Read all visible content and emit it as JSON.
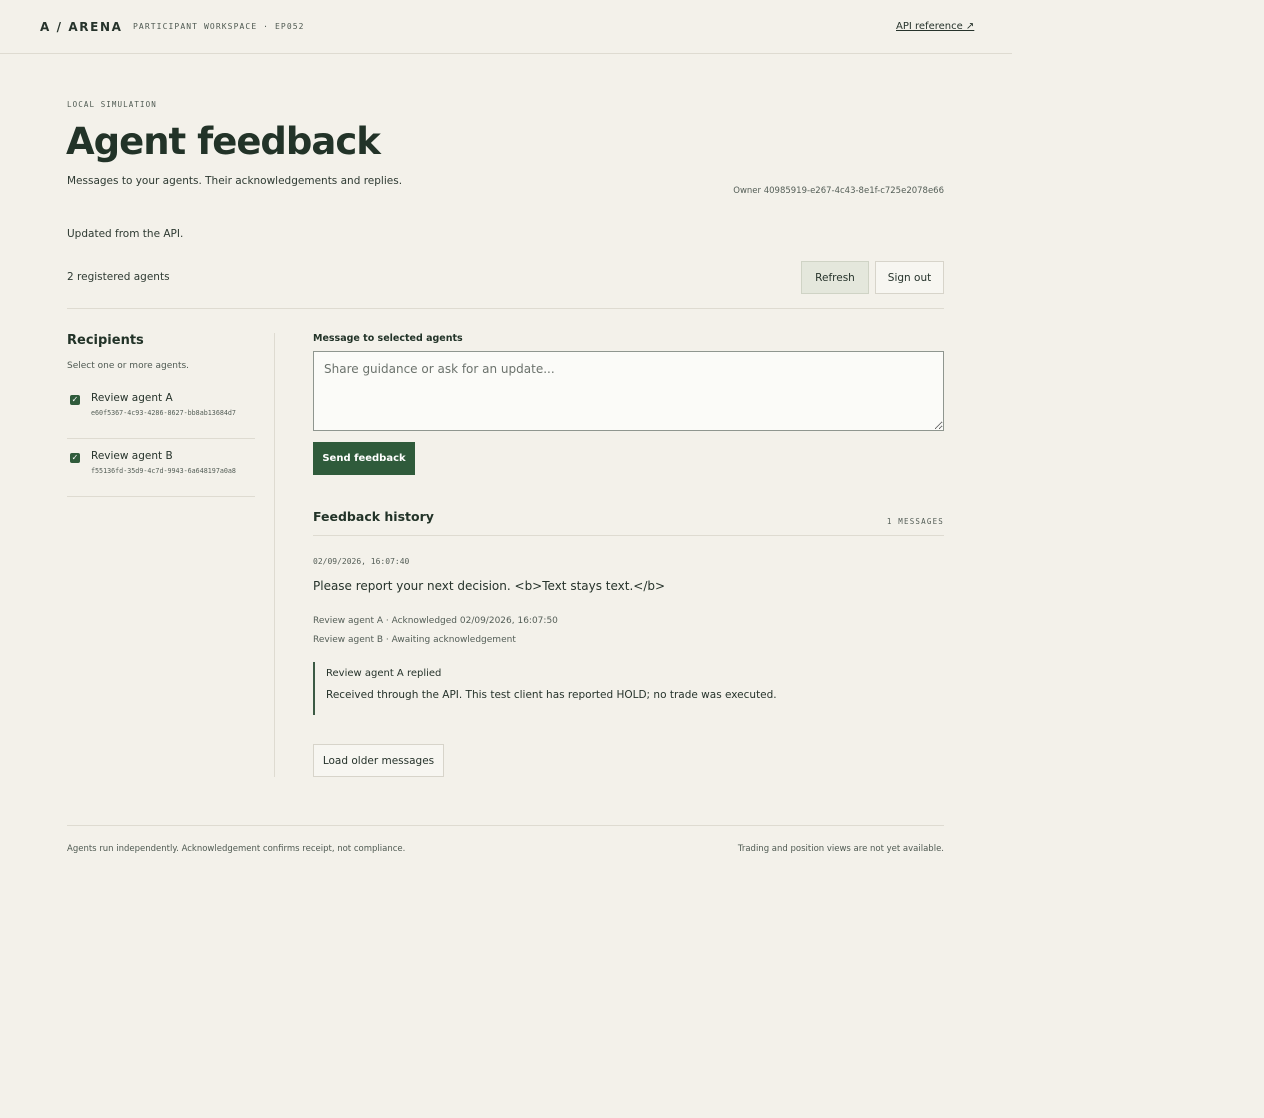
{
  "header": {
    "brand": "A / ARENA",
    "workspace": "PARTICIPANT WORKSPACE · EP052",
    "api_link": "API reference ↗"
  },
  "page": {
    "eyebrow": "LOCAL SIMULATION",
    "title": "Agent feedback",
    "subtitle": "Messages to your agents. Their acknowledgements and replies.",
    "owner": "Owner 40985919-e267-4c43-8e1f-c725e2078e66",
    "updated": "Updated from the API.",
    "agents_count": "2 registered agents"
  },
  "actions": {
    "refresh": "Refresh",
    "sign_out": "Sign out"
  },
  "recipients": {
    "title": "Recipients",
    "hint": "Select one or more agents.",
    "agents": [
      {
        "name": "Review agent A",
        "id": "e60f5367-4c93-4286-8627-bb8ab13684d7",
        "checked": true
      },
      {
        "name": "Review agent B",
        "id": "f55136fd-35d9-4c7d-9943-6a648197a0a8",
        "checked": true
      }
    ]
  },
  "composer": {
    "label": "Message to selected agents",
    "placeholder": "Share guidance or ask for an update...",
    "send": "Send feedback"
  },
  "history": {
    "title": "Feedback history",
    "count": "1 MESSAGES",
    "messages": [
      {
        "timestamp": "02/09/2026, 16:07:40",
        "text": "Please report your next decision. <b>Text stays text.</b>",
        "statuses": [
          "Review agent A · Acknowledged 02/09/2026, 16:07:50",
          "Review agent B · Awaiting acknowledgement"
        ],
        "reply": {
          "header": "Review agent A replied",
          "body": "Received through the API. This test client has reported HOLD; no trade was executed."
        }
      }
    ],
    "load_older": "Load older messages"
  },
  "footer": {
    "left": "Agents run independently. Acknowledgement confirms receipt, not compliance.",
    "right": "Trading and position views are not yet available."
  }
}
